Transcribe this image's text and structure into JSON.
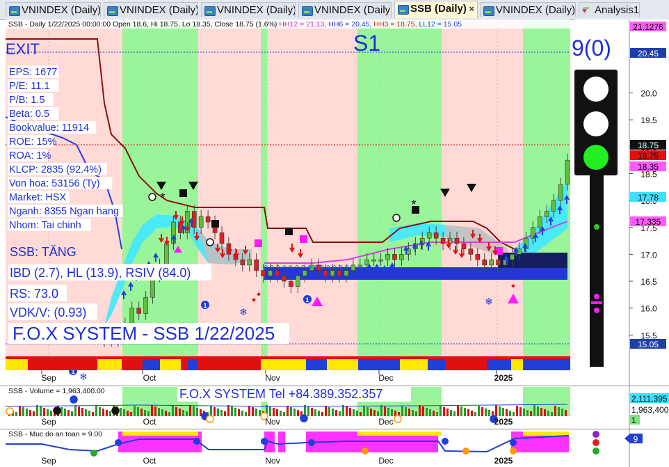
{
  "tabs": [
    {
      "label": "VNINDEX (Daily)",
      "active": false
    },
    {
      "label": "VNINDEX (Daily)",
      "active": false
    },
    {
      "label": "VNINDEX (Daily)",
      "active": false
    },
    {
      "label": "VNINDEX (Daily)",
      "active": false
    },
    {
      "label": "SSB (Daily)",
      "active": true
    },
    {
      "label": "VNINDEX (Daily)",
      "active": false
    },
    {
      "label": "Analysis1",
      "active": false
    }
  ],
  "tab_close_glyph": "×",
  "header_line": {
    "prefix": "SSB - Daily 1/22/2025 00:00:00 Open 18.6, Hi 18.75, Lo 18.35, Close 18.75 (1.6%)",
    "hh12": "HH12 = 21.13,",
    "hh6": "HH6 = 20.45,",
    "hh3": "HH3 = 18.75,",
    "ll12": "LL12 = 15.05"
  },
  "labels": {
    "exit": "EXIT",
    "s1": "S1",
    "score": "9(0)",
    "status": "SSB: TĂNG",
    "ibd": "IBD (2.7), HL (13.9), RSIV (84.0)",
    "rs": "RS: 73.0",
    "vdk": "VDK/V:  (0.93)",
    "system": "F.O.X SYSTEM - SSB 1/22/2025",
    "tel": "F.O.X SYSTEM Tel +84.389.352.357"
  },
  "fundamentals": [
    "EPS: 1677",
    "P/E: 11.1",
    "P/B: 1.5",
    "Beta: 0.5",
    "Bookvalue: 11914",
    "ROE: 15%",
    "ROA: 1%",
    "KLCP: 2835 (92.4%)",
    "Von hoa: 53156 (Ty)",
    "Market: HSX",
    "Nganh: 8355 Ngan hang",
    "Nhom: Tai chinh"
  ],
  "price_axis": {
    "ticks": [
      "20.0",
      "19.5",
      "19.0",
      "18.5",
      "18.0",
      "17.5",
      "17.0",
      "16.5",
      "16.0",
      "15.5"
    ],
    "tags": [
      {
        "text": "21.1276",
        "bg": "#ff5aff",
        "fg": "#000000"
      },
      {
        "text": "20.45",
        "bg": "#1f3fa6",
        "fg": "#ffffff"
      },
      {
        "text": "18.75",
        "bg": "#111111",
        "fg": "#ffffff"
      },
      {
        "text": "18.75",
        "bg": "#e01010",
        "fg": "#111111"
      },
      {
        "text": "18.35",
        "bg": "#ff5aff",
        "fg": "#000000"
      },
      {
        "text": "17.78",
        "bg": "#41e0ff",
        "fg": "#000000"
      },
      {
        "text": "17.335",
        "bg": "#ff5aff",
        "fg": "#000000"
      },
      {
        "text": "15.05",
        "bg": "#1f3fa6",
        "fg": "#ffffff"
      }
    ]
  },
  "months": [
    "Sep",
    "Oct",
    "Nov",
    "Dec",
    "2025"
  ],
  "volume_panel": {
    "title": "SSB - Volume = 1,963,400.00",
    "tags": [
      {
        "text": "2,111,395",
        "bg": "#41e0ff"
      },
      {
        "text": "1,963,400",
        "bg": "#ffffff"
      },
      {
        "text": "1",
        "bg": "#7ee07e"
      }
    ]
  },
  "mda_panel": {
    "title": "SSB - Muc do an toan = 9.00",
    "tag": "9"
  },
  "colors": {
    "green_zone": "#9af59a",
    "pink_zone": "#ffdad6",
    "up_candle": "#5fbf3f",
    "down_candle": "#e02020",
    "label_blue": "#1f2fd6",
    "traffic_green": "#22ee22"
  },
  "chart_data": {
    "type": "candlestick",
    "symbol": "SSB",
    "period": "Daily",
    "last_bar": {
      "date": "1/22/2025",
      "open": 18.6,
      "high": 18.75,
      "low": 18.35,
      "close": 18.75,
      "change_pct": 1.6
    },
    "levels": {
      "HH12": 21.13,
      "HH6": 20.45,
      "HH3": 18.75,
      "LL12": 15.05
    },
    "ylim": [
      15.0,
      21.2
    ],
    "x_labels": [
      "Sep",
      "Oct",
      "Nov",
      "Dec",
      "2025"
    ],
    "closes": [
      15.6,
      15.4,
      15.5,
      15.7,
      16.0,
      15.9,
      16.2,
      16.6,
      16.8,
      17.2,
      17.6,
      17.4,
      17.8,
      17.5,
      17.7,
      17.6,
      17.4,
      17.2,
      17.0,
      16.9,
      16.8,
      16.9,
      16.7,
      16.6,
      16.7,
      16.6,
      16.5,
      16.4,
      16.6,
      16.7,
      16.8,
      16.7,
      16.6,
      16.7,
      16.6,
      16.7,
      16.8,
      16.8,
      16.9,
      16.9,
      16.9,
      17.0,
      16.9,
      17.0,
      17.1,
      17.2,
      17.3,
      17.4,
      17.3,
      17.2,
      17.3,
      17.2,
      17.1,
      17.0,
      16.9,
      16.8,
      16.9,
      16.8,
      16.9,
      17.0,
      17.1,
      17.3,
      17.5,
      17.7,
      17.8,
      18.0,
      18.3,
      18.75
    ],
    "volume": {
      "last": 1963400,
      "max_visible": 2111395
    },
    "safety_level": 9.0
  }
}
